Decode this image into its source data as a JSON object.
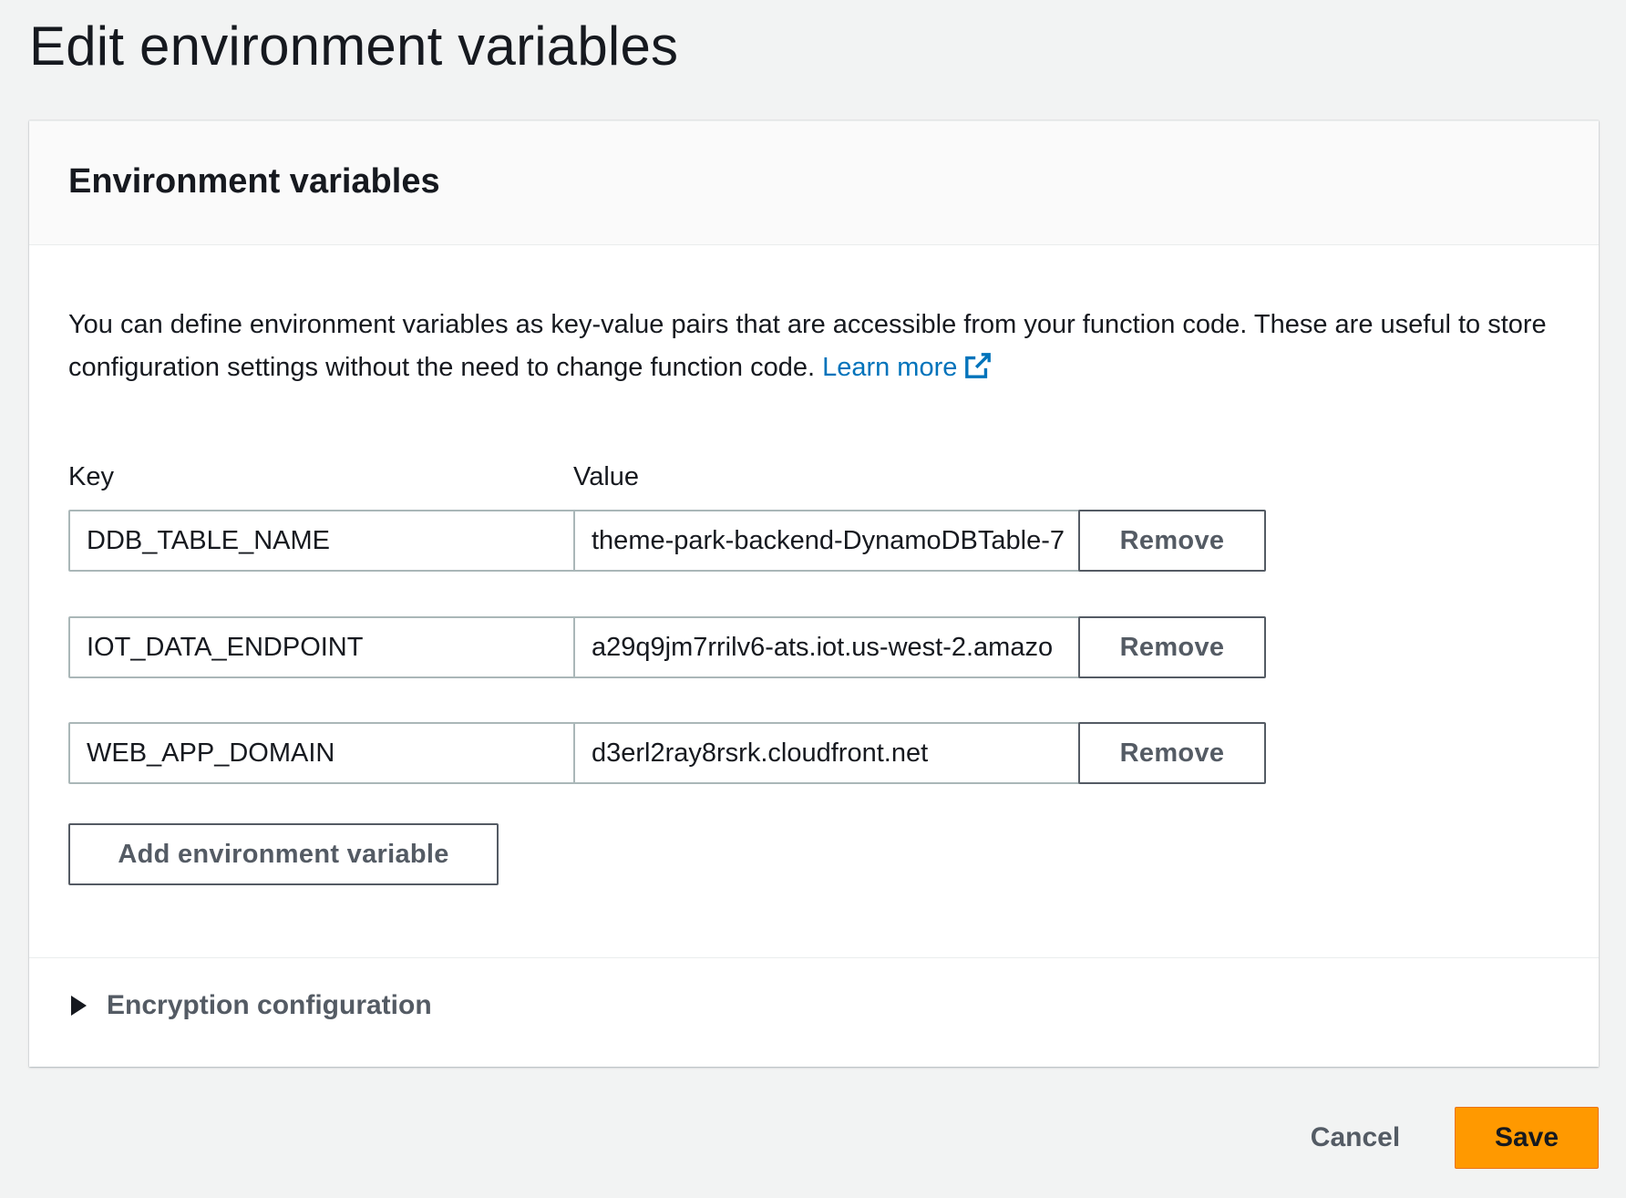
{
  "page": {
    "title": "Edit environment variables"
  },
  "panel": {
    "header": "Environment variables",
    "description": "You can define environment variables as key-value pairs that are accessible from your function code. These are useful to store configuration settings without the need to change function code.",
    "learn_more_label": "Learn more",
    "learn_more_icon": "external-link-icon",
    "key_column_label": "Key",
    "value_column_label": "Value",
    "rows": [
      {
        "key": "DDB_TABLE_NAME",
        "value": "theme-park-backend-DynamoDBTable-7",
        "remove_label": "Remove"
      },
      {
        "key": "IOT_DATA_ENDPOINT",
        "value": "a29q9jm7rrilv6-ats.iot.us-west-2.amazo",
        "remove_label": "Remove"
      },
      {
        "key": "WEB_APP_DOMAIN",
        "value": "d3erl2ray8rsrk.cloudfront.net",
        "remove_label": "Remove"
      }
    ],
    "add_button_label": "Add environment variable",
    "encryption_label": "Encryption configuration",
    "encryption_icon": "caret-right-icon"
  },
  "footer": {
    "cancel_label": "Cancel",
    "save_label": "Save"
  },
  "colors": {
    "background": "#f2f3f3",
    "link": "#0073bb",
    "primary_button": "#ff9900",
    "secondary_text": "#545b64"
  }
}
